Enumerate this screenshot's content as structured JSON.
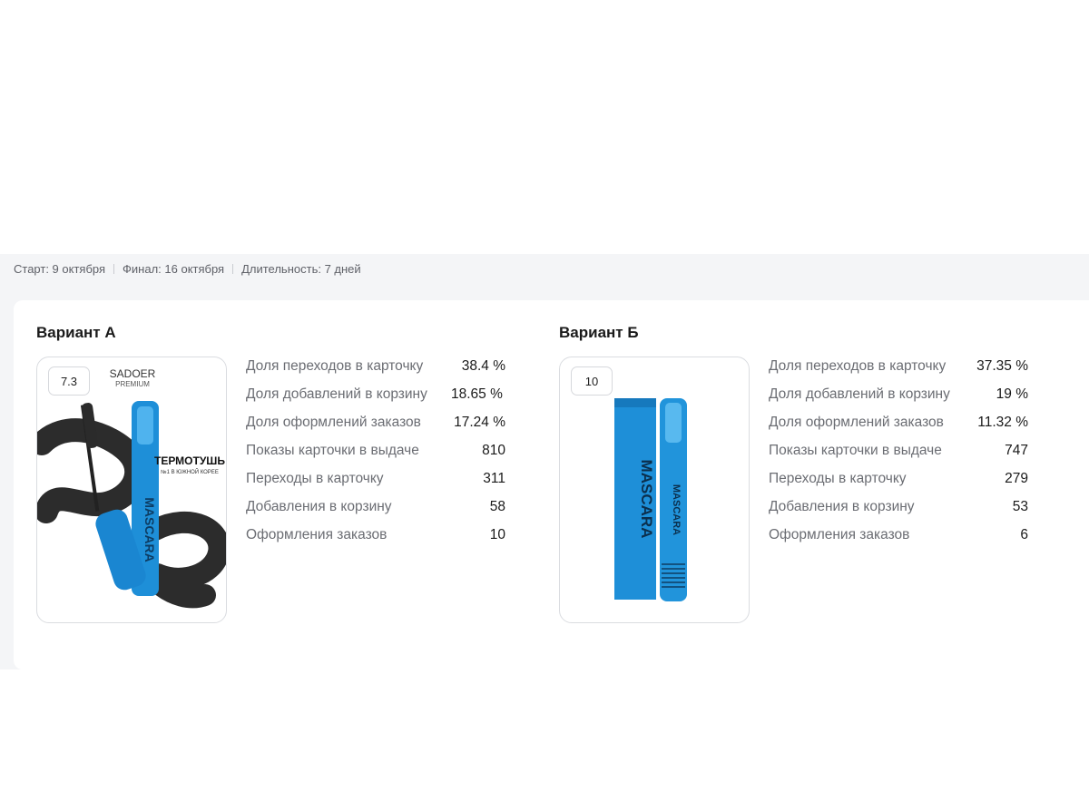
{
  "meta": {
    "start": "Старт: 9 октября",
    "finish": "Финал: 16 октября",
    "duration": "Длительность: 7 дней"
  },
  "variant_a": {
    "title": "Вариант А",
    "score": "7.3",
    "product_text": {
      "brand": "SADOER",
      "brand_sub": "PREMIUM",
      "headline": "ТЕРМОТУШЬ",
      "subline": "№1 В ЮЖНОЙ КОРЕЕ",
      "tube": "MASCARA"
    },
    "metrics": [
      {
        "label": "Доля переходов в карточку",
        "value": "38.4 %"
      },
      {
        "label": "Доля добавлений в корзину",
        "value": "18.65 %"
      },
      {
        "label": "Доля оформлений заказов",
        "value": "17.24 %"
      },
      {
        "label": "Показы карточки в выдаче",
        "value": "810"
      },
      {
        "label": "Переходы в карточку",
        "value": "311"
      },
      {
        "label": "Добавления в корзину",
        "value": "58"
      },
      {
        "label": "Оформления заказов",
        "value": "10"
      }
    ]
  },
  "variant_b": {
    "title": "Вариант Б",
    "score": "10",
    "product_text": {
      "box": "MASCARA",
      "tube": "MASCARA"
    },
    "metrics": [
      {
        "label": "Доля переходов в карточку",
        "value": "37.35 %"
      },
      {
        "label": "Доля добавлений в корзину",
        "value": "19 %"
      },
      {
        "label": "Доля оформлений заказов",
        "value": "11.32 %"
      },
      {
        "label": "Показы карточки в выдаче",
        "value": "747"
      },
      {
        "label": "Переходы в карточку",
        "value": "279"
      },
      {
        "label": "Добавления в корзину",
        "value": "53"
      },
      {
        "label": "Оформления заказов",
        "value": "6"
      }
    ]
  },
  "colors": {
    "panel_bg": "#f4f5f7",
    "card_bg": "#ffffff",
    "mascara_blue": "#1e8fd8",
    "muted_text": "#6b6d73"
  }
}
